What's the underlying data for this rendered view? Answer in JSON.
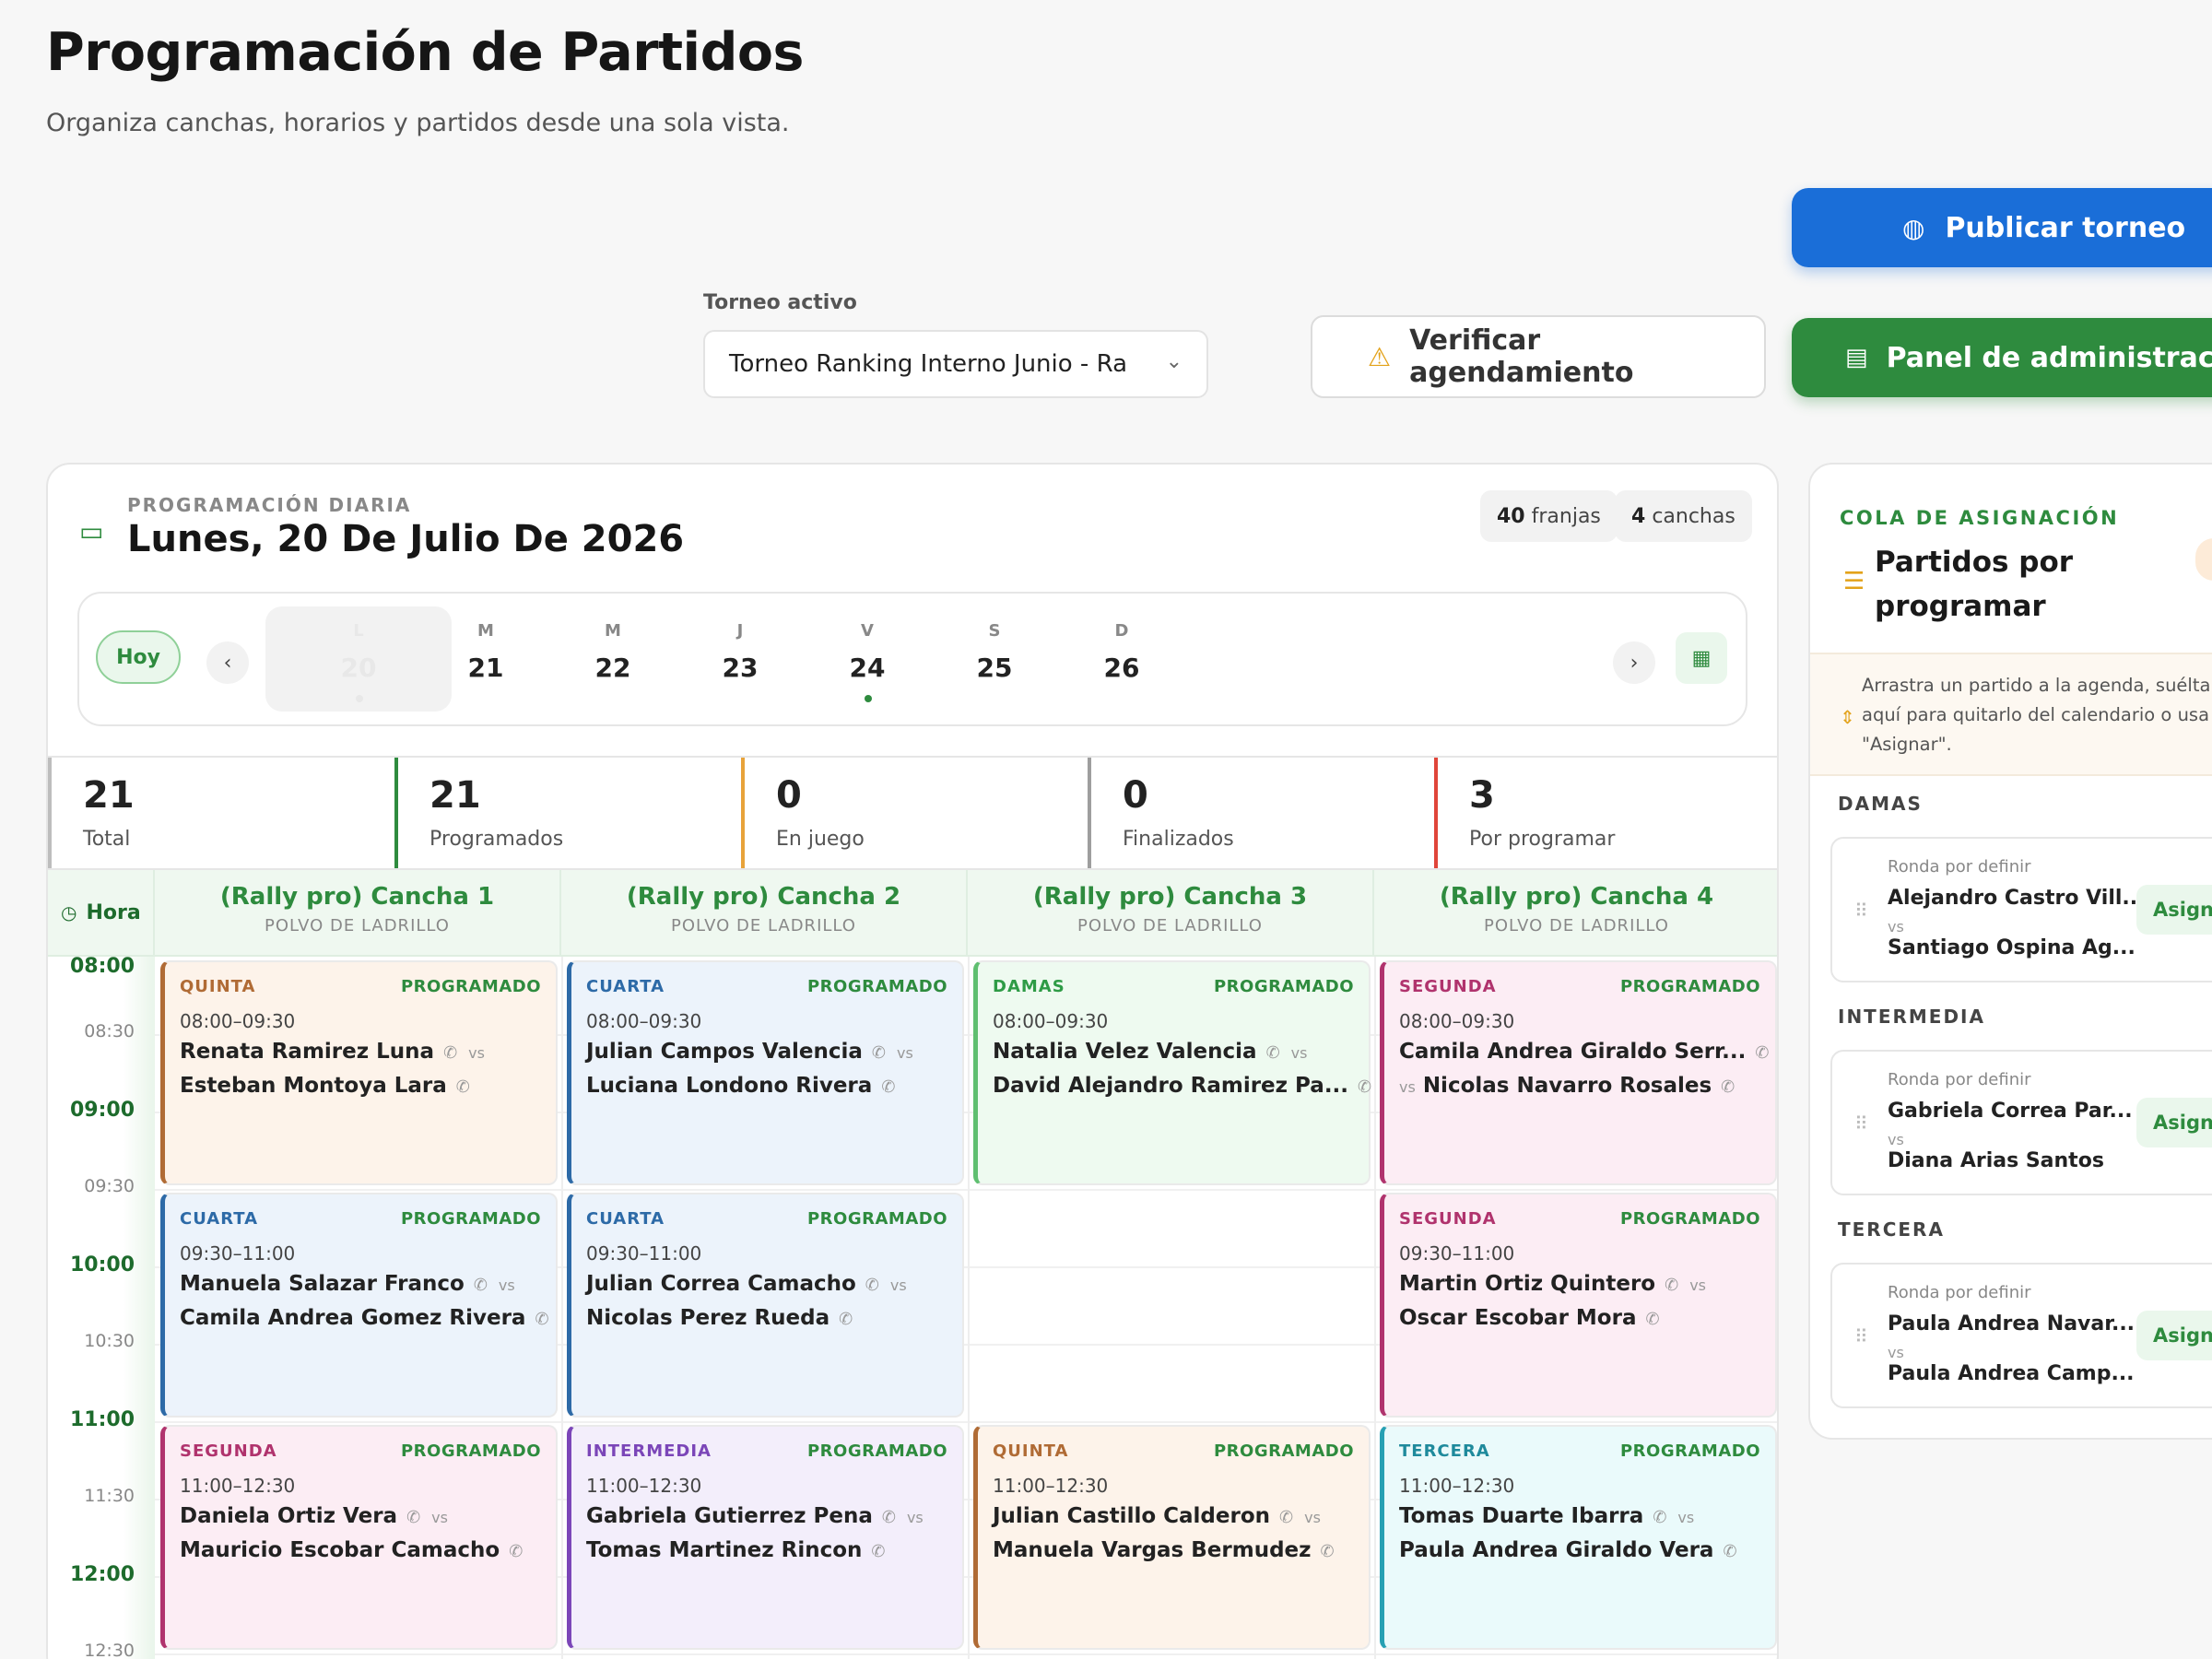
{
  "page": {
    "title": "Programación de Partidos",
    "subtitle": "Organiza canchas, horarios y partidos desde una sola vista."
  },
  "actions": {
    "publish_label": "Publicar torneo",
    "admin_label": "Panel de administración",
    "verify_label": "Verificar agendamiento"
  },
  "torneo": {
    "label": "Torneo activo",
    "value": "Torneo Ranking Interno Junio - Ra"
  },
  "schedule": {
    "eyebrow": "PROGRAMACIÓN DIARIA",
    "date_title": "Lunes, 20 De Julio De 2026",
    "slots_count": "40",
    "slots_label": "franjas",
    "courts_count": "4",
    "courts_label": "canchas",
    "today_label": "Hoy",
    "days": [
      {
        "letter": "L",
        "num": "20",
        "selected": true,
        "dot": true
      },
      {
        "letter": "M",
        "num": "21",
        "selected": false,
        "dot": false
      },
      {
        "letter": "M",
        "num": "22",
        "selected": false,
        "dot": false
      },
      {
        "letter": "J",
        "num": "23",
        "selected": false,
        "dot": false
      },
      {
        "letter": "V",
        "num": "24",
        "selected": false,
        "dot": true
      },
      {
        "letter": "S",
        "num": "25",
        "selected": false,
        "dot": false
      },
      {
        "letter": "D",
        "num": "26",
        "selected": false,
        "dot": false
      }
    ]
  },
  "stats": [
    {
      "value": "21",
      "label": "Total",
      "color": "#bdbdbd"
    },
    {
      "value": "21",
      "label": "Programados",
      "color": "#2e8b3e"
    },
    {
      "value": "0",
      "label": "En juego",
      "color": "#e8a33a"
    },
    {
      "value": "0",
      "label": "Finalizados",
      "color": "#9e9e9e"
    },
    {
      "value": "3",
      "label": "Por programar",
      "color": "#e0453a"
    }
  ],
  "grid": {
    "hora_label": "Hora",
    "courts": [
      {
        "name": "(Rally pro) Cancha 1",
        "surface": "POLVO DE LADRILLO"
      },
      {
        "name": "(Rally pro) Cancha 2",
        "surface": "POLVO DE LADRILLO"
      },
      {
        "name": "(Rally pro) Cancha 3",
        "surface": "POLVO DE LADRILLO"
      },
      {
        "name": "(Rally pro) Cancha 4",
        "surface": "POLVO DE LADRILLO"
      }
    ],
    "times": [
      {
        "label": "08:00",
        "kind": "hour"
      },
      {
        "label": "08:30",
        "kind": "half"
      },
      {
        "label": "09:00",
        "kind": "hour"
      },
      {
        "label": "09:30",
        "kind": "half"
      },
      {
        "label": "10:00",
        "kind": "hour"
      },
      {
        "label": "10:30",
        "kind": "half"
      },
      {
        "label": "11:00",
        "kind": "hour"
      },
      {
        "label": "11:30",
        "kind": "half"
      },
      {
        "label": "12:00",
        "kind": "hour"
      },
      {
        "label": "12:30",
        "kind": "half"
      }
    ],
    "vs_label": "vs",
    "matches": [
      {
        "court": 0,
        "slot": 0,
        "category": "QUINTA",
        "theme": "quinta",
        "status": "PROGRAMADO",
        "time": "08:00–09:30",
        "p1": "Renata Ramirez Luna",
        "p2": "Esteban Montoya Lara"
      },
      {
        "court": 1,
        "slot": 0,
        "category": "CUARTA",
        "theme": "cuarta",
        "status": "PROGRAMADO",
        "time": "08:00–09:30",
        "p1": "Julian Campos Valencia",
        "p2": "Luciana Londono Rivera"
      },
      {
        "court": 2,
        "slot": 0,
        "category": "DAMAS",
        "theme": "damas",
        "status": "PROGRAMADO",
        "time": "08:00–09:30",
        "p1": "Natalia Velez Valencia",
        "p2": "David Alejandro Ramirez Pa..."
      },
      {
        "court": 3,
        "slot": 0,
        "category": "SEGUNDA",
        "theme": "segunda",
        "status": "PROGRAMADO",
        "time": "08:00–09:30",
        "p1": "Camila Andrea Giraldo Serr...",
        "p2": "Nicolas Navarro Rosales",
        "vs_before_p2": true
      },
      {
        "court": 0,
        "slot": 1,
        "category": "CUARTA",
        "theme": "cuarta",
        "status": "PROGRAMADO",
        "time": "09:30–11:00",
        "p1": "Manuela Salazar Franco",
        "p2": "Camila Andrea Gomez Rivera"
      },
      {
        "court": 1,
        "slot": 1,
        "category": "CUARTA",
        "theme": "cuarta",
        "status": "PROGRAMADO",
        "time": "09:30–11:00",
        "p1": "Julian Correa Camacho",
        "p2": "Nicolas Perez Rueda"
      },
      {
        "court": 3,
        "slot": 1,
        "category": "SEGUNDA",
        "theme": "segunda",
        "status": "PROGRAMADO",
        "time": "09:30–11:00",
        "p1": "Martin Ortiz Quintero",
        "p2": "Oscar Escobar Mora"
      },
      {
        "court": 0,
        "slot": 2,
        "category": "SEGUNDA",
        "theme": "segunda",
        "status": "PROGRAMADO",
        "time": "11:00–12:30",
        "p1": "Daniela Ortiz Vera",
        "p2": "Mauricio Escobar Camacho"
      },
      {
        "court": 1,
        "slot": 2,
        "category": "INTERMEDIA",
        "theme": "intermedia",
        "status": "PROGRAMADO",
        "time": "11:00–12:30",
        "p1": "Gabriela Gutierrez Pena",
        "p2": "Tomas Martinez Rincon"
      },
      {
        "court": 2,
        "slot": 2,
        "category": "QUINTA",
        "theme": "quinta",
        "status": "PROGRAMADO",
        "time": "11:00–12:30",
        "p1": "Julian Castillo Calderon",
        "p2": "Manuela Vargas Bermudez"
      },
      {
        "court": 3,
        "slot": 2,
        "category": "TERCERA",
        "theme": "tercera",
        "status": "PROGRAMADO",
        "time": "11:00–12:30",
        "p1": "Tomas Duarte Ibarra",
        "p2": "Paula Andrea Giraldo Vera"
      }
    ]
  },
  "queue": {
    "eyebrow": "COLA DE ASIGNACIÓN",
    "title": "Partidos por programar",
    "hint": "Arrastra un partido a la agenda, suélta\naquí para quitarlo del calendario o usa\n\"Asignar\".",
    "assign_label": "Asignar",
    "vs_label": "vs",
    "groups": [
      {
        "name": "DAMAS",
        "round": "Ronda por definir",
        "a": "Alejandro Castro Vill...",
        "b": "Santiago Ospina Ag..."
      },
      {
        "name": "INTERMEDIA",
        "round": "Ronda por definir",
        "a": "Gabriela Correa Par...",
        "b": "Diana Arias Santos"
      },
      {
        "name": "TERCERA",
        "round": "Ronda por definir",
        "a": "Paula Andrea Navar...",
        "b": "Paula Andrea Camp..."
      }
    ]
  }
}
